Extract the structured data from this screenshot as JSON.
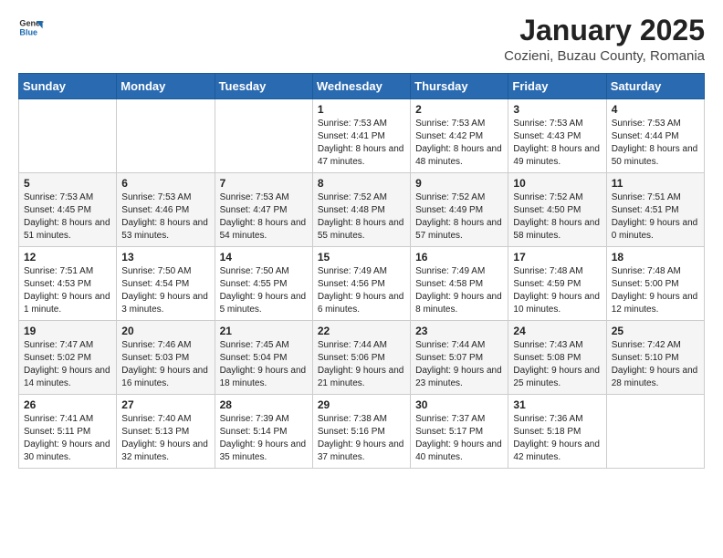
{
  "header": {
    "logo_general": "General",
    "logo_blue": "Blue",
    "month_title": "January 2025",
    "location": "Cozieni, Buzau County, Romania"
  },
  "days_of_week": [
    "Sunday",
    "Monday",
    "Tuesday",
    "Wednesday",
    "Thursday",
    "Friday",
    "Saturday"
  ],
  "weeks": [
    [
      {
        "day": "",
        "info": ""
      },
      {
        "day": "",
        "info": ""
      },
      {
        "day": "",
        "info": ""
      },
      {
        "day": "1",
        "info": "Sunrise: 7:53 AM\nSunset: 4:41 PM\nDaylight: 8 hours and 47 minutes."
      },
      {
        "day": "2",
        "info": "Sunrise: 7:53 AM\nSunset: 4:42 PM\nDaylight: 8 hours and 48 minutes."
      },
      {
        "day": "3",
        "info": "Sunrise: 7:53 AM\nSunset: 4:43 PM\nDaylight: 8 hours and 49 minutes."
      },
      {
        "day": "4",
        "info": "Sunrise: 7:53 AM\nSunset: 4:44 PM\nDaylight: 8 hours and 50 minutes."
      }
    ],
    [
      {
        "day": "5",
        "info": "Sunrise: 7:53 AM\nSunset: 4:45 PM\nDaylight: 8 hours and 51 minutes."
      },
      {
        "day": "6",
        "info": "Sunrise: 7:53 AM\nSunset: 4:46 PM\nDaylight: 8 hours and 53 minutes."
      },
      {
        "day": "7",
        "info": "Sunrise: 7:53 AM\nSunset: 4:47 PM\nDaylight: 8 hours and 54 minutes."
      },
      {
        "day": "8",
        "info": "Sunrise: 7:52 AM\nSunset: 4:48 PM\nDaylight: 8 hours and 55 minutes."
      },
      {
        "day": "9",
        "info": "Sunrise: 7:52 AM\nSunset: 4:49 PM\nDaylight: 8 hours and 57 minutes."
      },
      {
        "day": "10",
        "info": "Sunrise: 7:52 AM\nSunset: 4:50 PM\nDaylight: 8 hours and 58 minutes."
      },
      {
        "day": "11",
        "info": "Sunrise: 7:51 AM\nSunset: 4:51 PM\nDaylight: 9 hours and 0 minutes."
      }
    ],
    [
      {
        "day": "12",
        "info": "Sunrise: 7:51 AM\nSunset: 4:53 PM\nDaylight: 9 hours and 1 minute."
      },
      {
        "day": "13",
        "info": "Sunrise: 7:50 AM\nSunset: 4:54 PM\nDaylight: 9 hours and 3 minutes."
      },
      {
        "day": "14",
        "info": "Sunrise: 7:50 AM\nSunset: 4:55 PM\nDaylight: 9 hours and 5 minutes."
      },
      {
        "day": "15",
        "info": "Sunrise: 7:49 AM\nSunset: 4:56 PM\nDaylight: 9 hours and 6 minutes."
      },
      {
        "day": "16",
        "info": "Sunrise: 7:49 AM\nSunset: 4:58 PM\nDaylight: 9 hours and 8 minutes."
      },
      {
        "day": "17",
        "info": "Sunrise: 7:48 AM\nSunset: 4:59 PM\nDaylight: 9 hours and 10 minutes."
      },
      {
        "day": "18",
        "info": "Sunrise: 7:48 AM\nSunset: 5:00 PM\nDaylight: 9 hours and 12 minutes."
      }
    ],
    [
      {
        "day": "19",
        "info": "Sunrise: 7:47 AM\nSunset: 5:02 PM\nDaylight: 9 hours and 14 minutes."
      },
      {
        "day": "20",
        "info": "Sunrise: 7:46 AM\nSunset: 5:03 PM\nDaylight: 9 hours and 16 minutes."
      },
      {
        "day": "21",
        "info": "Sunrise: 7:45 AM\nSunset: 5:04 PM\nDaylight: 9 hours and 18 minutes."
      },
      {
        "day": "22",
        "info": "Sunrise: 7:44 AM\nSunset: 5:06 PM\nDaylight: 9 hours and 21 minutes."
      },
      {
        "day": "23",
        "info": "Sunrise: 7:44 AM\nSunset: 5:07 PM\nDaylight: 9 hours and 23 minutes."
      },
      {
        "day": "24",
        "info": "Sunrise: 7:43 AM\nSunset: 5:08 PM\nDaylight: 9 hours and 25 minutes."
      },
      {
        "day": "25",
        "info": "Sunrise: 7:42 AM\nSunset: 5:10 PM\nDaylight: 9 hours and 28 minutes."
      }
    ],
    [
      {
        "day": "26",
        "info": "Sunrise: 7:41 AM\nSunset: 5:11 PM\nDaylight: 9 hours and 30 minutes."
      },
      {
        "day": "27",
        "info": "Sunrise: 7:40 AM\nSunset: 5:13 PM\nDaylight: 9 hours and 32 minutes."
      },
      {
        "day": "28",
        "info": "Sunrise: 7:39 AM\nSunset: 5:14 PM\nDaylight: 9 hours and 35 minutes."
      },
      {
        "day": "29",
        "info": "Sunrise: 7:38 AM\nSunset: 5:16 PM\nDaylight: 9 hours and 37 minutes."
      },
      {
        "day": "30",
        "info": "Sunrise: 7:37 AM\nSunset: 5:17 PM\nDaylight: 9 hours and 40 minutes."
      },
      {
        "day": "31",
        "info": "Sunrise: 7:36 AM\nSunset: 5:18 PM\nDaylight: 9 hours and 42 minutes."
      },
      {
        "day": "",
        "info": ""
      }
    ]
  ]
}
